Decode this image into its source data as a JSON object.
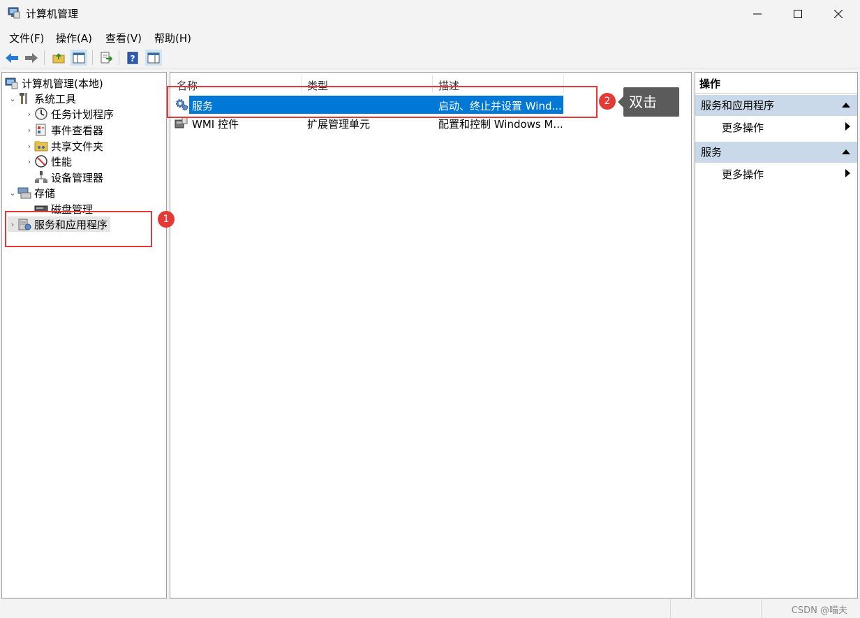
{
  "window": {
    "title": "计算机管理",
    "icon": "computer-management-icon"
  },
  "menu": [
    {
      "label": "文件(F)"
    },
    {
      "label": "操作(A)"
    },
    {
      "label": "查看(V)"
    },
    {
      "label": "帮助(H)"
    }
  ],
  "toolbar": {
    "buttons": [
      "back-arrow-icon",
      "forward-arrow-icon",
      "up-folder-icon",
      "show-hide-tree-icon",
      "export-list-icon",
      "help-icon",
      "show-hide-action-pane-icon"
    ]
  },
  "tree": {
    "items": [
      {
        "label": "计算机管理(本地)",
        "icon": "computer-management-icon",
        "expander": "",
        "level": 0
      },
      {
        "label": "系统工具",
        "icon": "tools-icon",
        "expander": "⌄",
        "level": 1
      },
      {
        "label": "任务计划程序",
        "icon": "clock-icon",
        "expander": "›",
        "level": 2
      },
      {
        "label": "事件查看器",
        "icon": "event-viewer-icon",
        "expander": "›",
        "level": 2
      },
      {
        "label": "共享文件夹",
        "icon": "shared-folder-icon",
        "expander": "›",
        "level": 2
      },
      {
        "label": "性能",
        "icon": "performance-icon",
        "expander": "›",
        "level": 2
      },
      {
        "label": "设备管理器",
        "icon": "device-manager-icon",
        "expander": "",
        "level": 2
      },
      {
        "label": "存储",
        "icon": "storage-icon",
        "expander": "⌄",
        "level": 1
      },
      {
        "label": "磁盘管理",
        "icon": "disk-icon",
        "expander": "",
        "level": 2
      },
      {
        "label": "服务和应用程序",
        "icon": "services-apps-icon",
        "expander": "›",
        "level": 1
      }
    ]
  },
  "list": {
    "columns": [
      "名称",
      "类型",
      "描述"
    ],
    "rows": [
      {
        "name": "服务",
        "type": "",
        "desc": "启动、终止并设置 Wind...",
        "icon": "gear-icon",
        "selected": true
      },
      {
        "name": "WMI 控件",
        "type": "扩展管理单元",
        "desc": "配置和控制 Windows M...",
        "icon": "wmi-icon",
        "selected": false
      }
    ]
  },
  "actions": {
    "title": "操作",
    "sections": [
      {
        "label": "服务和应用程序",
        "item": "更多操作"
      },
      {
        "label": "服务",
        "item": "更多操作"
      }
    ]
  },
  "annotations": {
    "badge1": "1",
    "badge2": "2",
    "tooltip": "双击",
    "color": "#e53935"
  },
  "status": {
    "watermark": "CSDN @喵夫"
  },
  "colors": {
    "selection": "#0078d7",
    "action_header": "#c9d9ea"
  }
}
